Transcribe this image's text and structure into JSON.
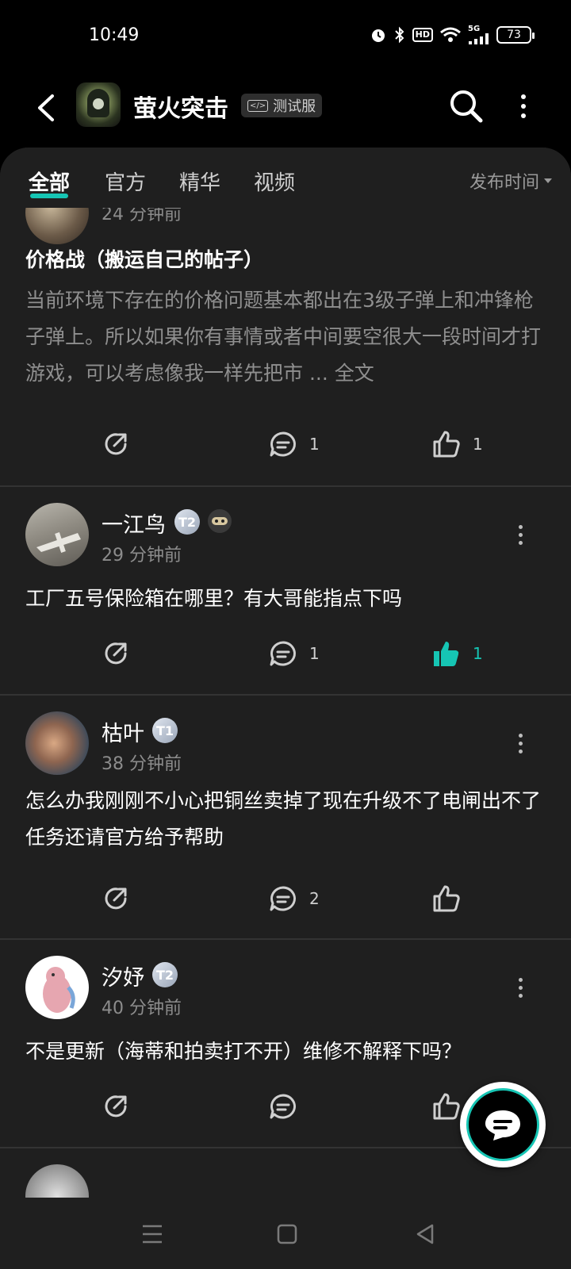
{
  "status_bar": {
    "time": "10:49",
    "hd": "HD",
    "network": "5G",
    "battery": "73"
  },
  "header": {
    "app_name": "萤火突击",
    "badge": "测试服",
    "badge_icon": "</>"
  },
  "tabs": {
    "items": [
      "全部",
      "官方",
      "精华",
      "视频"
    ],
    "active": "全部",
    "sort_label": "发布时间"
  },
  "posts": [
    {
      "username": "",
      "time": "24 分钟前",
      "title": "价格战（搬运自己的帖子）",
      "body": "当前环境下存在的价格问题基本都出在3级子弹上和冲锋枪子弹上。所以如果你有事情或者中间要空很大一段时间才打游戏，可以考虑像我一样先把市",
      "more": "... 全文",
      "comments": "1",
      "likes": "1",
      "liked": false
    },
    {
      "username": "一江鸟",
      "level": "T2",
      "time": "29 分钟前",
      "body": "工厂五号保险箱在哪里？有大哥能指点下吗",
      "comments": "1",
      "likes": "1",
      "liked": true
    },
    {
      "username": "枯叶",
      "level": "T1",
      "time": "38 分钟前",
      "body": "怎么办我刚刚不小心把铜丝卖掉了现在升级不了电闸出不了任务还请官方给予帮助",
      "comments": "2",
      "likes": "",
      "liked": false
    },
    {
      "username": "汐妤",
      "level": "T2",
      "time": "40 分钟前",
      "body": "不是更新（海蒂和拍卖打不开）维修不解释下吗？",
      "comments": "",
      "likes": "",
      "liked": false
    }
  ],
  "colors": {
    "accent": "#16c5b4",
    "background": "#1f1f1f",
    "header_bg": "#000000"
  }
}
